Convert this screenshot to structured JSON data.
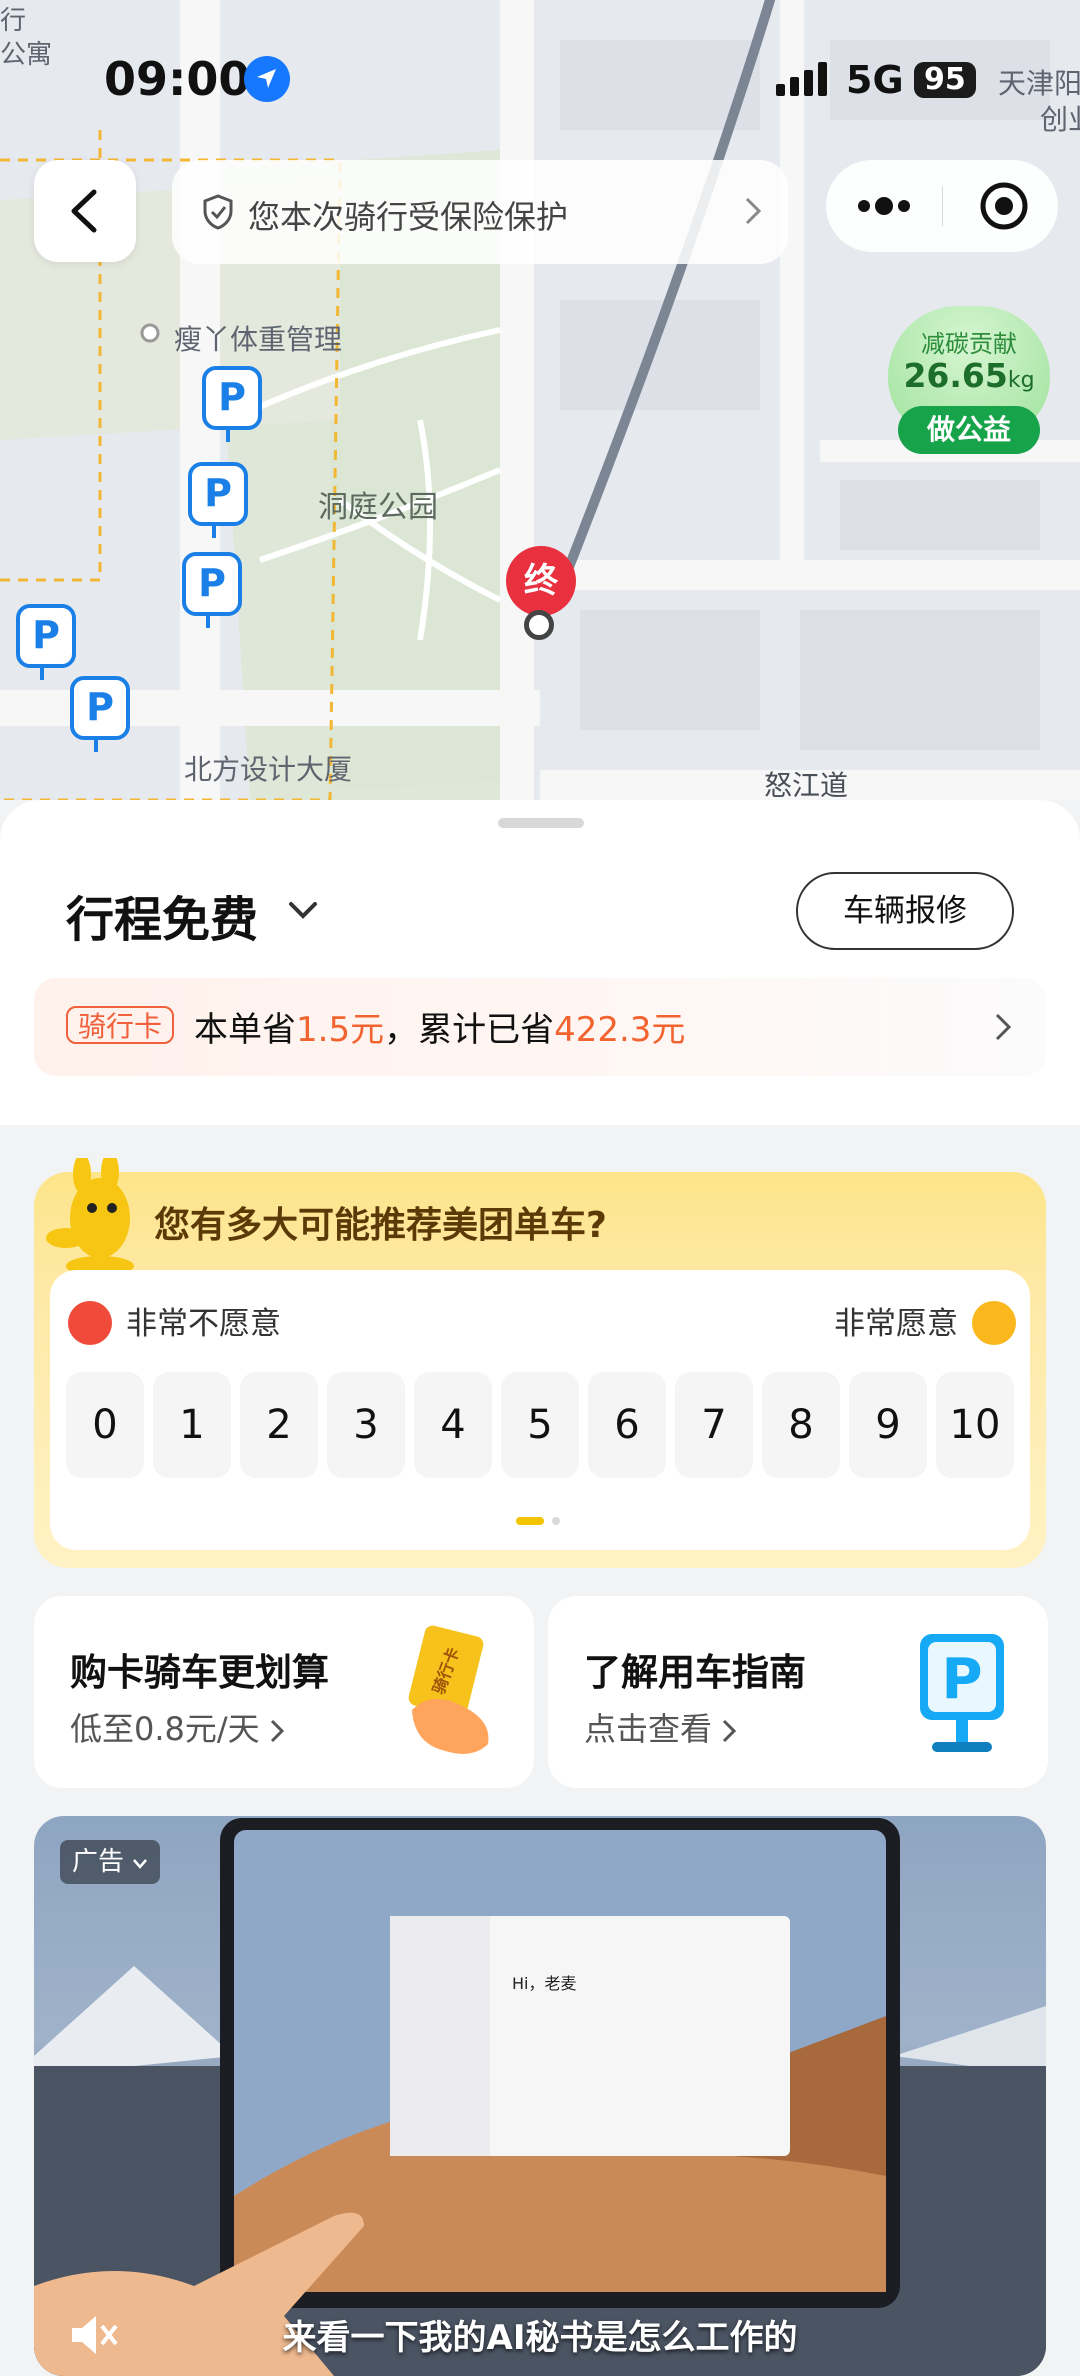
{
  "status_bar": {
    "time": "09:00",
    "network": "5G",
    "battery": "95"
  },
  "map": {
    "labels": {
      "gym": "瘦丫体重管理",
      "park": "洞庭公园",
      "building": "北方设计大厦",
      "road": "怒江道",
      "city_top_right_1": "天津阳",
      "city_top_right_2": "创业",
      "top_left_1": "行",
      "top_left_2": "公寓"
    },
    "end_marker": "终",
    "parking_glyph": "P"
  },
  "top_bar": {
    "insurance_text": "您本次骑行受保险保护"
  },
  "carbon": {
    "label": "减碳贡献",
    "value": "26.65",
    "unit": "kg",
    "button": "做公益"
  },
  "trip": {
    "title": "行程免费",
    "repair_button": "车辆报修"
  },
  "ride_card": {
    "tag": "骑行卡",
    "text_prefix": "本单省",
    "saved_now": "1.5元",
    "text_mid": "，累计已省",
    "saved_total": "422.3元"
  },
  "survey": {
    "question": "您有多大可能推荐美团单车?",
    "left_label": "非常不愿意",
    "right_label": "非常愿意",
    "scores": [
      "0",
      "1",
      "2",
      "3",
      "4",
      "5",
      "6",
      "7",
      "8",
      "9",
      "10"
    ]
  },
  "cards": {
    "buy": {
      "title": "购卡骑车更划算",
      "sub": "低至0.8元/天",
      "badge": "骑行卡"
    },
    "guide": {
      "title": "了解用车指南",
      "sub": "点击查看",
      "badge": "P"
    }
  },
  "ad": {
    "tag": "广告",
    "caption": "来看一下我的AI秘书是怎么工作的",
    "screen_greeting": "Hi，老麦"
  }
}
